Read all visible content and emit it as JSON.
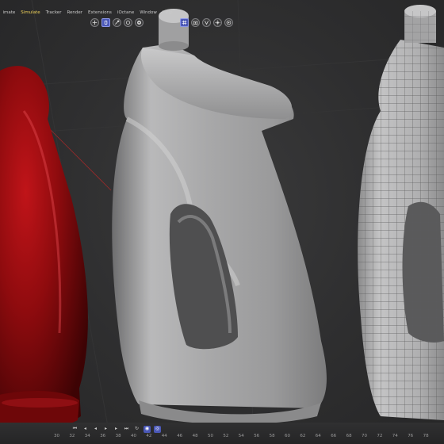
{
  "menubar": {
    "items": [
      {
        "label": "imate",
        "active": false
      },
      {
        "label": "Simulate",
        "active": true
      },
      {
        "label": "Tracker",
        "active": false
      },
      {
        "label": "Render",
        "active": false
      },
      {
        "label": "Extensions",
        "active": false
      },
      {
        "label": "iOctane",
        "active": false
      },
      {
        "label": "Window",
        "active": false
      },
      {
        "label": "Help",
        "active": false
      }
    ]
  },
  "toolbar": {
    "left_buttons": [
      "move-icon",
      "select-icon",
      "scale-icon",
      "rotate-icon",
      "render-icon"
    ],
    "right_buttons": [
      "grid-icon",
      "camera-icon",
      "snap-icon",
      "light-icon",
      "record-icon"
    ]
  },
  "timeline": {
    "transport": [
      "skip-start-icon",
      "step-back-icon",
      "play-back-icon",
      "play-icon",
      "step-forward-icon",
      "skip-end-icon",
      "record-keyframe-icon"
    ],
    "frames": [
      "30",
      "32",
      "34",
      "36",
      "38",
      "40",
      "42",
      "44",
      "46",
      "48",
      "50",
      "52",
      "54",
      "56",
      "58",
      "60",
      "62",
      "64",
      "66",
      "68",
      "70",
      "72",
      "74",
      "76",
      "78"
    ]
  },
  "colors": {
    "accent": "#4b58b7",
    "active_menu": "#f0d35a",
    "bottle_red": "#8e0b0e",
    "clay": "#a9a9aa"
  }
}
